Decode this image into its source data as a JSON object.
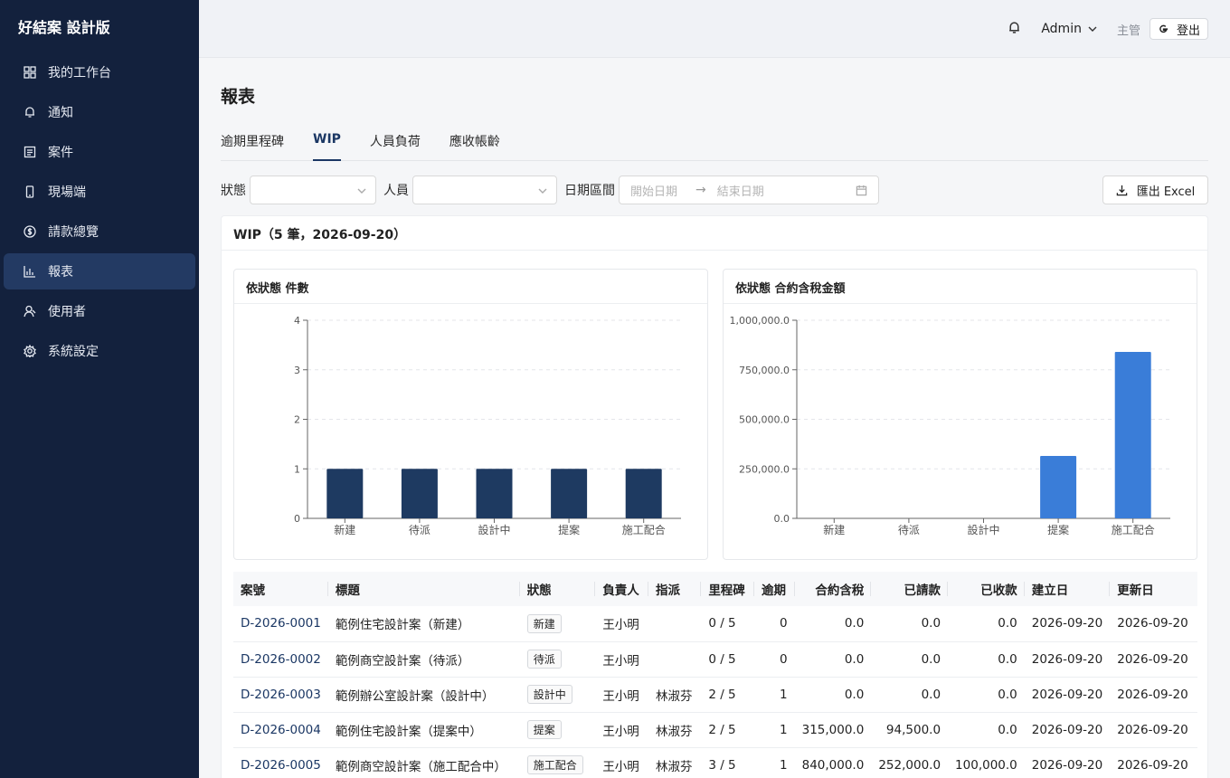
{
  "brand": "好結案 設計版",
  "sidebar": {
    "items": [
      {
        "label": "我的工作台",
        "icon": "grid-icon"
      },
      {
        "label": "通知",
        "icon": "bell-icon"
      },
      {
        "label": "案件",
        "icon": "document-icon"
      },
      {
        "label": "現場端",
        "icon": "mobile-icon"
      },
      {
        "label": "請款總覽",
        "icon": "dollar-icon"
      },
      {
        "label": "報表",
        "icon": "bar-chart-icon",
        "active": true
      },
      {
        "label": "使用者",
        "icon": "user-icon"
      },
      {
        "label": "系統設定",
        "icon": "gear-icon"
      }
    ]
  },
  "header": {
    "user": "Admin",
    "role": "主管",
    "logout": "登出"
  },
  "page": {
    "title": "報表",
    "tabs": [
      {
        "label": "逾期里程碑"
      },
      {
        "label": "WIP",
        "active": true
      },
      {
        "label": "人員負荷"
      },
      {
        "label": "應收帳齡"
      }
    ]
  },
  "filters": {
    "status_label": "狀態",
    "person_label": "人員",
    "date_label": "日期區間",
    "start_placeholder": "開始日期",
    "end_placeholder": "結束日期",
    "export_label": "匯出 Excel"
  },
  "card": {
    "title": "WIP（5 筆，2026-09-20）"
  },
  "chart_data": [
    {
      "type": "bar",
      "title": "依狀態 件數",
      "categories": [
        "新建",
        "待派",
        "設計中",
        "提案",
        "施工配合"
      ],
      "values": [
        1,
        1,
        1,
        1,
        1
      ],
      "ylim": [
        0,
        4
      ],
      "yticks": [
        0,
        1,
        2,
        3,
        4
      ],
      "ytick_labels": [
        "0",
        "1",
        "2",
        "3",
        "4"
      ],
      "color": "#1e3a61",
      "grid": true
    },
    {
      "type": "bar",
      "title": "依狀態 合約含稅金額",
      "categories": [
        "新建",
        "待派",
        "設計中",
        "提案",
        "施工配合"
      ],
      "values": [
        0,
        0,
        0,
        315000,
        840000
      ],
      "ylim": [
        0,
        1000000
      ],
      "yticks": [
        0,
        250000,
        500000,
        750000,
        1000000
      ],
      "ytick_labels": [
        "0.0",
        "250,000.0",
        "500,000.0",
        "750,000.0",
        "1,000,000.0"
      ],
      "color": "#3a7dd8",
      "grid": true
    }
  ],
  "table": {
    "columns": [
      "案號",
      "標題",
      "狀態",
      "負責人",
      "指派",
      "里程碑",
      "逾期",
      "合約含稅",
      "已請款",
      "已收款",
      "建立日",
      "更新日"
    ],
    "rows": [
      [
        "D-2026-0001",
        "範例住宅設計案（新建）",
        "新建",
        "王小明",
        "",
        "0 / 5",
        "0",
        "0.0",
        "0.0",
        "0.0",
        "2026-09-20",
        "2026-09-20"
      ],
      [
        "D-2026-0002",
        "範例商空設計案（待派）",
        "待派",
        "王小明",
        "",
        "0 / 5",
        "0",
        "0.0",
        "0.0",
        "0.0",
        "2026-09-20",
        "2026-09-20"
      ],
      [
        "D-2026-0003",
        "範例辦公室設計案（設計中）",
        "設計中",
        "王小明",
        "林淑芬",
        "2 / 5",
        "1",
        "0.0",
        "0.0",
        "0.0",
        "2026-09-20",
        "2026-09-20"
      ],
      [
        "D-2026-0004",
        "範例住宅設計案（提案中）",
        "提案",
        "王小明",
        "林淑芬",
        "2 / 5",
        "1",
        "315,000.0",
        "94,500.0",
        "0.0",
        "2026-09-20",
        "2026-09-20"
      ],
      [
        "D-2026-0005",
        "範例商空設計案（施工配合中）",
        "施工配合",
        "王小明",
        "林淑芬",
        "3 / 5",
        "1",
        "840,000.0",
        "252,000.0",
        "100,000.0",
        "2026-09-20",
        "2026-09-20"
      ]
    ]
  }
}
